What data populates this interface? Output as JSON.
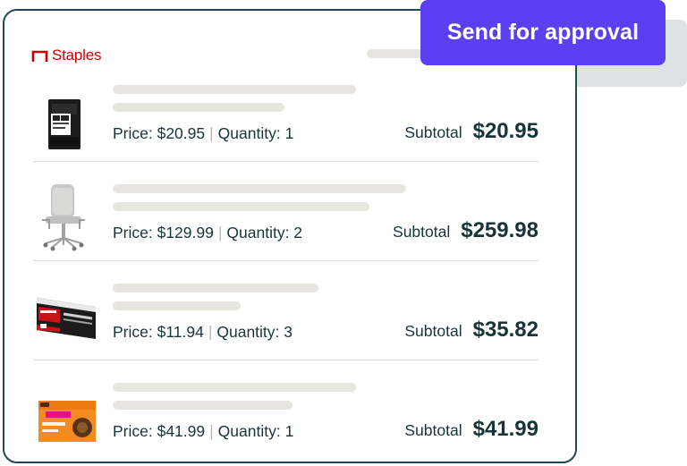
{
  "brand": {
    "name": "Staples",
    "color": "#cc0000"
  },
  "action": {
    "label": "Send for approval",
    "color": "#5b3ff0"
  },
  "items": [
    {
      "product": "ink-cartridge",
      "price_label": "Price: $20.95",
      "quantity_label": "Quantity: 1",
      "subtotal_label": "Subtotal",
      "subtotal": "$20.95"
    },
    {
      "product": "office-chair",
      "price_label": "Price: $129.99",
      "quantity_label": "Quantity: 2",
      "subtotal_label": "Subtotal",
      "subtotal": "$259.98"
    },
    {
      "product": "sharpie-markers",
      "price_label": "Price: $11.94",
      "quantity_label": "Quantity: 3",
      "subtotal_label": "Subtotal",
      "subtotal": "$35.82"
    },
    {
      "product": "dunkin-coffee-pods",
      "price_label": "Price: $41.99",
      "quantity_label": "Quantity: 1",
      "subtotal_label": "Subtotal",
      "subtotal": "$41.99"
    }
  ],
  "separator": "|"
}
